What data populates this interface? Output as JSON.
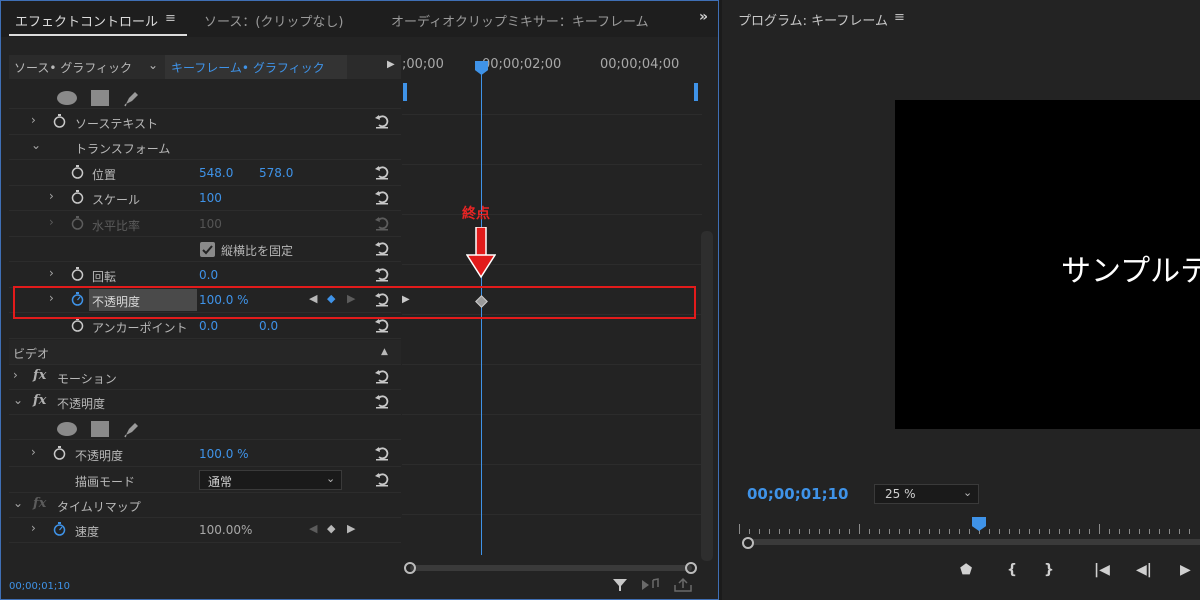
{
  "tabs": {
    "effect_controls": "エフェクトコントロール",
    "source": "ソース：(クリップなし)",
    "audio_mixer": "オーディオクリップミキサー：キーフレーム",
    "menu_glyph": "≡",
    "overflow_glyph": "»"
  },
  "subheader": {
    "source_label": "ソース• グラフィック",
    "chevron": "⌄",
    "clip_label": "キーフレーム• グラフィック",
    "play_glyph": "▶"
  },
  "ruler": {
    "t0": ";00;00",
    "t1": "00;00;02;00",
    "t2": "00;00;04;00"
  },
  "properties": {
    "source_text": "ソーステキスト",
    "transform": "トランスフォーム",
    "position_label": "位置",
    "position_x": "548.0",
    "position_y": "578.0",
    "scale_label": "スケール",
    "scale_value": "100",
    "hscale_label": "水平比率",
    "hscale_value": "100",
    "uniform_label": "縦横比を固定",
    "rotation_label": "回転",
    "rotation_value": "0.0",
    "opacity_label": "不透明度",
    "opacity_value": "100.0 %",
    "anchor_label": "アンカーポイント",
    "anchor_x": "0.0",
    "anchor_y": "0.0"
  },
  "video": {
    "header": "ビデオ",
    "motion": "モーション",
    "opacity_effect": "不透明度",
    "opacity_label": "不透明度",
    "opacity_value": "100.0 %",
    "blend_label": "描画モード",
    "blend_value": "通常",
    "time_remap": "タイムリマップ",
    "speed_label": "速度",
    "speed_value": "100.00%"
  },
  "glyphs": {
    "twisty_closed": "›",
    "twisty_open": "⌄",
    "fx": "fx",
    "kf_prev": "◀",
    "kf_add": "◆",
    "kf_next": "▶",
    "collapse_up": "▲",
    "select_chev": "⌄"
  },
  "annotation": {
    "label": "終点"
  },
  "footer": {
    "timecode": "00;00;01;10"
  },
  "program": {
    "title": "プログラム: キーフレーム",
    "preview_text": "サンプルテ",
    "timecode": "00;00;01;10",
    "zoom": "25 %",
    "controls": {
      "marker": "⬟",
      "mark_in": "{",
      "mark_out": "}",
      "go_to_in": "|◀",
      "step_back": "◀|",
      "play": "▶"
    }
  },
  "colors": {
    "accent": "#3f93e8",
    "highlight": "#e21b1b",
    "panel": "#232323"
  }
}
